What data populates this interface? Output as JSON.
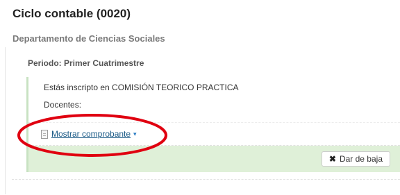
{
  "course": {
    "title": "Ciclo contable (0020)",
    "department": "Departamento de Ciencias Sociales"
  },
  "period": {
    "label": "Periodo: Primer Cuatrimestre"
  },
  "enrollment": {
    "status_text": "Estás inscripto en COMISIÓN TEORICO PRACTICA",
    "teachers_label": "Docentes:",
    "show_receipt_label": "Mostrar comprobante",
    "show_receipt_icon": "document-icon",
    "caret_glyph": "▾",
    "drop_button_label": "Dar de baja",
    "drop_button_icon": "close-icon"
  },
  "colors": {
    "success_bar": "#dff0d8",
    "success_border": "#c8e2c2",
    "link": "#1a5a86",
    "annotation_ellipse": "#e00010"
  }
}
